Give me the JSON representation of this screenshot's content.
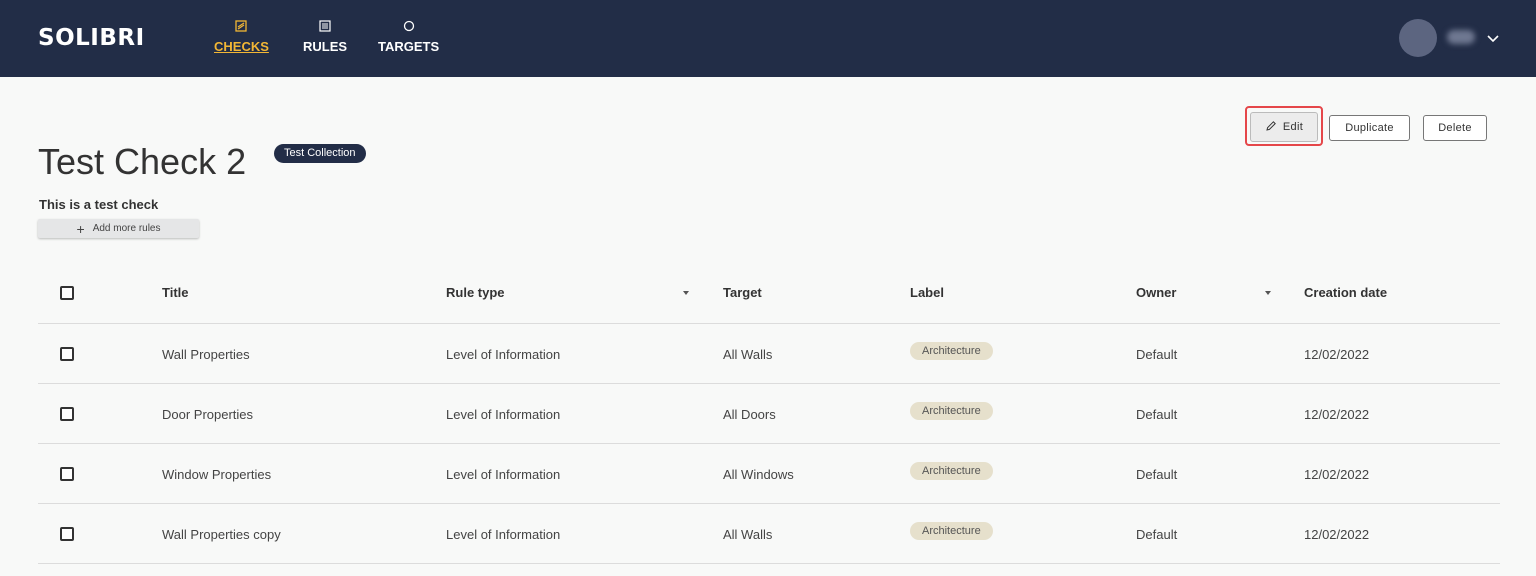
{
  "header": {
    "logo": "SOLIBRI",
    "nav": [
      {
        "label": "CHECKS",
        "icon": "checks-icon",
        "active": true
      },
      {
        "label": "RULES",
        "icon": "rules-icon",
        "active": false
      },
      {
        "label": "TARGETS",
        "icon": "targets-icon",
        "active": false
      }
    ],
    "accent_color": "#f2b635",
    "bar_color": "#222d47"
  },
  "check": {
    "title": "Test Check 2",
    "collection": "Test Collection",
    "description": "This is a test check",
    "add_rules_label": "Add more rules"
  },
  "actions": {
    "edit": "Edit",
    "duplicate": "Duplicate",
    "delete": "Delete"
  },
  "table": {
    "columns": {
      "title": "Title",
      "rule_type": "Rule type",
      "target": "Target",
      "label": "Label",
      "owner": "Owner",
      "creation_date": "Creation date"
    },
    "rows": [
      {
        "title": "Wall Properties",
        "rule_type": "Level of Information",
        "target": "All Walls",
        "label": "Architecture",
        "owner": "Default",
        "date": "12/02/2022"
      },
      {
        "title": "Door Properties",
        "rule_type": "Level of Information",
        "target": "All Doors",
        "label": "Architecture",
        "owner": "Default",
        "date": "12/02/2022"
      },
      {
        "title": "Window Properties",
        "rule_type": "Level of Information",
        "target": "All Windows",
        "label": "Architecture",
        "owner": "Default",
        "date": "12/02/2022"
      },
      {
        "title": "Wall Properties copy",
        "rule_type": "Level of Information",
        "target": "All Walls",
        "label": "Architecture",
        "owner": "Default",
        "date": "12/02/2022"
      }
    ]
  }
}
